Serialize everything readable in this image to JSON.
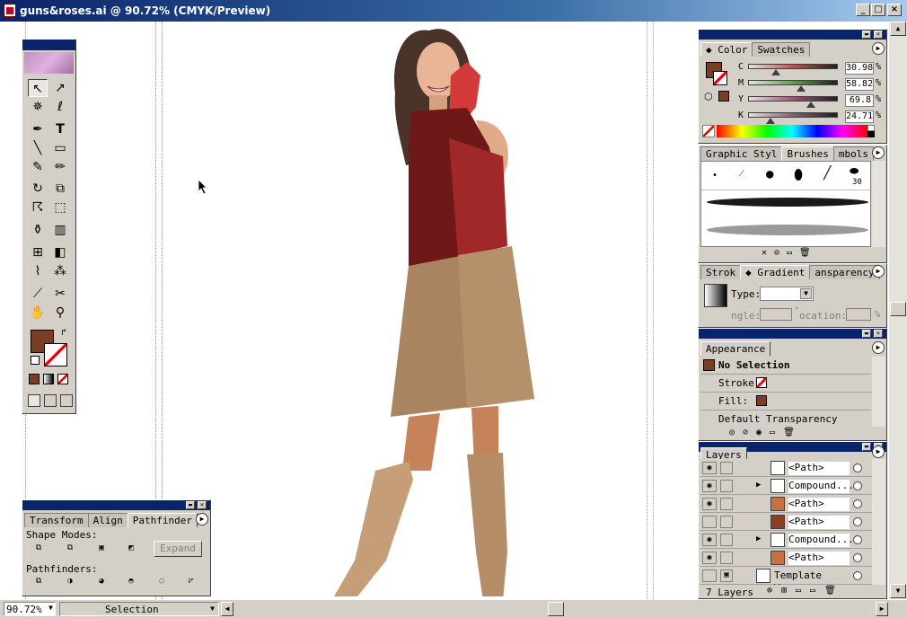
{
  "window": {
    "title": "guns&roses.ai @ 90.72% (CMYK/Preview)",
    "min": "_",
    "max": "□",
    "close": "×"
  },
  "status": {
    "zoom": "90.72%",
    "mode": "Selection"
  },
  "color_panel": {
    "tabs": [
      "Color",
      "Swatches"
    ],
    "channels": [
      {
        "label": "C",
        "value": "30.98",
        "unit": "%",
        "pos": 0.31,
        "color": "#c05050"
      },
      {
        "label": "M",
        "value": "58.82",
        "unit": "%",
        "pos": 0.59,
        "color": "#60a050"
      },
      {
        "label": "Y",
        "value": "69.8",
        "unit": "%",
        "pos": 0.7,
        "color": "#a05080"
      },
      {
        "label": "K",
        "value": "24.71",
        "unit": "%",
        "pos": 0.25,
        "color": "#806070"
      }
    ]
  },
  "brushes_panel": {
    "tabs": [
      "Graphic Styl",
      "Brushes",
      "mbols"
    ],
    "brush_size": "30"
  },
  "gradient_panel": {
    "tabs": [
      "Strok",
      "Gradient",
      "ansparency"
    ],
    "type_label": "Type:",
    "angle_label": "ngle:",
    "location_label": "ocation:",
    "angle_unit": "°",
    "location_unit": "%"
  },
  "appearance_panel": {
    "tab": "Appearance",
    "selection": "No Selection",
    "stroke_label": "Stroke:",
    "fill_label": "Fill:",
    "transparency": "Default Transparency"
  },
  "layers_panel": {
    "tab": "Layers",
    "footer": "7 Layers",
    "rows": [
      {
        "name": "<Path>",
        "eye": true,
        "expand": false
      },
      {
        "name": "Compound...",
        "eye": true,
        "expand": true
      },
      {
        "name": "<Path>",
        "eye": true,
        "expand": false
      },
      {
        "name": "<Path>",
        "eye": false,
        "expand": false
      },
      {
        "name": "Compound...",
        "eye": true,
        "expand": true
      },
      {
        "name": "<Path>",
        "eye": true,
        "expand": false
      },
      {
        "name": "Template W...",
        "eye": false,
        "expand": true
      }
    ]
  },
  "pathfinder_panel": {
    "tabs": [
      "Transform",
      "Align",
      "Pathfinder"
    ],
    "shape_modes": "Shape Modes:",
    "expand": "Expand",
    "pathfinders": "Pathfinders:"
  },
  "tools": {
    "type_glyph": "T"
  },
  "colors": {
    "fill": "#7a3e24",
    "accent": "#0a246a"
  }
}
